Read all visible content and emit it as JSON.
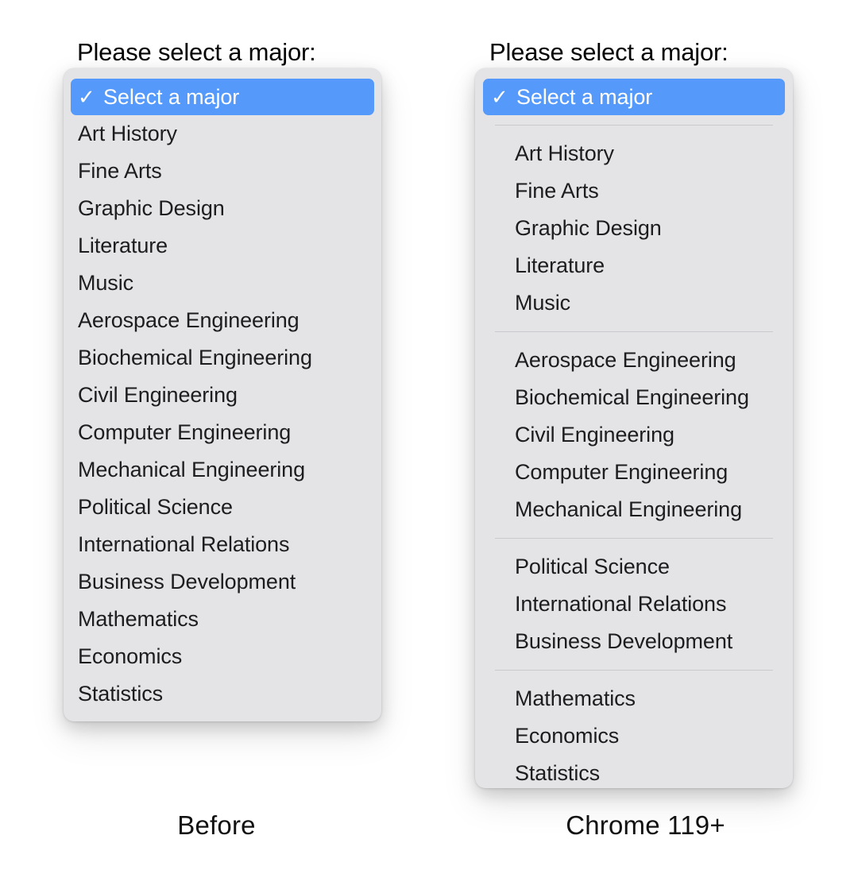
{
  "page": {
    "background_color": "#ffffff",
    "panel_background_color": "#e4e4e7",
    "highlight_color": "#559afa",
    "separator_color": "#c9c9ce",
    "text_color": "#1d1d1f"
  },
  "before": {
    "prompt_label": "Please select a major:",
    "caption": "Before",
    "check_glyph": "✓",
    "selected_option": "Select a major",
    "options": [
      "Select a major",
      "Art History",
      "Fine Arts",
      "Graphic Design",
      "Literature",
      "Music",
      "Aerospace Engineering",
      "Biochemical Engineering",
      "Civil Engineering",
      "Computer Engineering",
      "Mechanical Engineering",
      "Political Science",
      "International Relations",
      "Business Development",
      "Mathematics",
      "Economics",
      "Statistics"
    ]
  },
  "after": {
    "prompt_label": "Please select a major:",
    "caption": "Chrome 119+",
    "check_glyph": "✓",
    "selected_option": "Select a major",
    "groups": [
      {
        "items": [
          "Art History",
          "Fine Arts",
          "Graphic Design",
          "Literature",
          "Music"
        ]
      },
      {
        "items": [
          "Aerospace Engineering",
          "Biochemical Engineering",
          "Civil Engineering",
          "Computer Engineering",
          "Mechanical Engineering"
        ]
      },
      {
        "items": [
          "Political Science",
          "International Relations",
          "Business Development"
        ]
      },
      {
        "items": [
          "Mathematics",
          "Economics",
          "Statistics"
        ]
      }
    ]
  }
}
